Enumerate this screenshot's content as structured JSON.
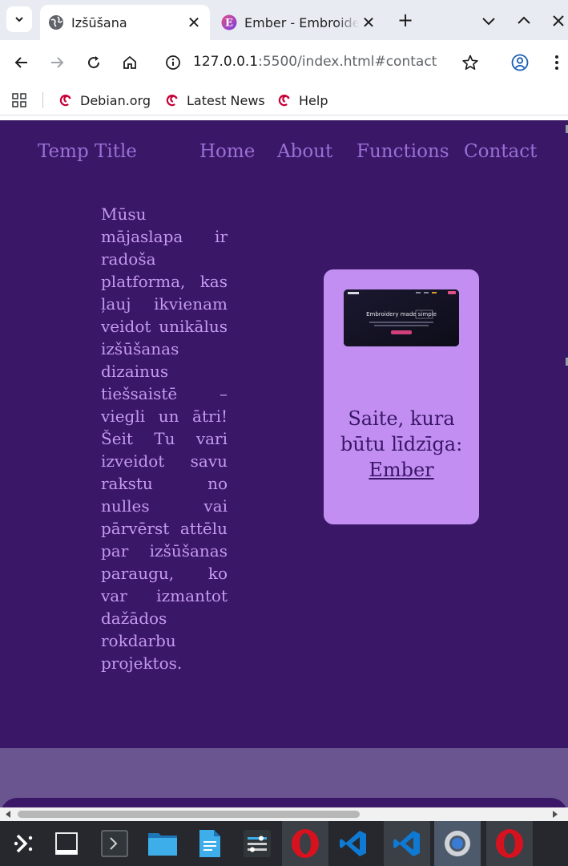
{
  "browser": {
    "tabs": [
      {
        "title": "Izšūšana",
        "icon": "globe-icon",
        "active": true
      },
      {
        "title": "Ember - Embroidery",
        "icon": "ember-e-icon",
        "active": false
      }
    ],
    "new_tab_icon": "plus-icon",
    "address_host": "127.0.0.1",
    "address_path": ":5500/index.html#contact",
    "bookmarks": [
      {
        "label": "Debian.org",
        "icon": "debian-swirl-icon"
      },
      {
        "label": "Latest News",
        "icon": "debian-swirl-icon"
      },
      {
        "label": "Help",
        "icon": "debian-swirl-icon"
      }
    ]
  },
  "page": {
    "nav": {
      "brand": "Temp Title",
      "links": [
        "Home",
        "About",
        "Functions",
        "Contact"
      ]
    },
    "intro_text": "Mūsu mājaslapa ir radoša platforma, kas ļauj ikvienam veidot unikālus izšūšanas dizainus tiešsaistē – viegli un ātri! Šeit Tu vari izveidot savu rakstu no nulles vai pārvērst attēlu par izšūšanas paraugu, ko var izmantot dažādos rokdarbu projektos.",
    "card": {
      "screenshot_heading": "Embroidery made simple",
      "caption": "Saite, kura būtu līdzīga:",
      "link_label": "Ember"
    }
  },
  "colors": {
    "page_background": "#3a1767",
    "nav_text": "#9b6fd6",
    "body_text": "#c59af0",
    "card_background": "#c28ef2",
    "footer_band": "#6a5590"
  },
  "taskbar": {
    "apps": [
      "app-launcher-icon",
      "show-desktop-icon",
      "terminal-icon",
      "file-manager-icon",
      "text-editor-icon",
      "system-settings-icon",
      "opera-icon",
      "vscode-icon",
      "vscode-icon",
      "chrome-icon",
      "opera-icon"
    ]
  }
}
